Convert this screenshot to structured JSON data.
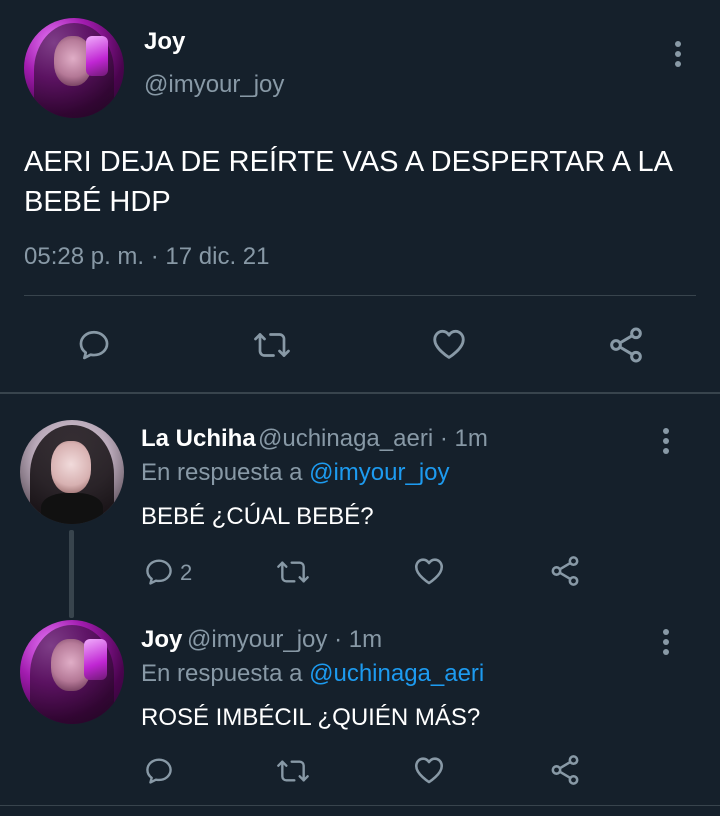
{
  "main_tweet": {
    "name": "Joy",
    "handle": "@imyour_joy",
    "text": "AERI DEJA DE REÍRTE VAS A DESPERTAR A LA BEBÉ HDP",
    "timestamp": "05:28 p. m. · 17 dic. 21"
  },
  "replies": [
    {
      "name": "La Uchiha",
      "handle_time": "@uchinaga_aeri · 1m",
      "reply_prefix": "En respuesta a",
      "reply_mention": "@imyour_joy",
      "text": "BEBÉ ¿CÚAL BEBÉ?",
      "reply_count": "2"
    },
    {
      "name": "Joy",
      "handle_time": "@imyour_joy · 1m",
      "reply_prefix": "En respuesta a",
      "reply_mention": "@uchinaga_aeri",
      "text": "ROSÉ IMBÉCIL ¿QUIÉN MÁS?"
    }
  ],
  "colors": {
    "background": "#15202b",
    "text": "#ffffff",
    "secondary": "#8899a6",
    "link": "#1d9bf0",
    "divider": "#38444d"
  },
  "icons": [
    "reply-icon",
    "retweet-icon",
    "like-icon",
    "share-icon",
    "more-icon"
  ]
}
